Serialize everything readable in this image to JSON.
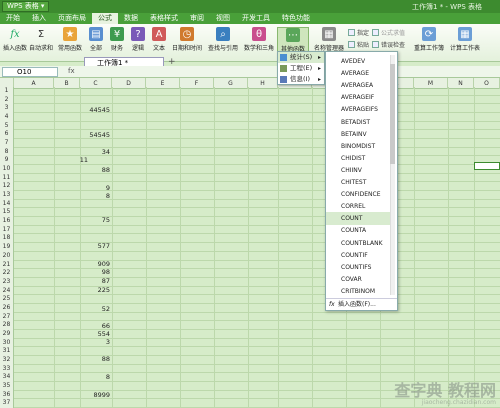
{
  "titlebar": {
    "app_name": "WPS 表格",
    "doc_title": "工作簿1 * - WPS 表格"
  },
  "menu": [
    "开始",
    "插入",
    "页面布局",
    "公式",
    "数据",
    "表格样式",
    "审阅",
    "视图",
    "开发工具",
    "特色功能"
  ],
  "ribbon": {
    "insert_function": "插入函数",
    "autosum": "自动求和",
    "common_functions": "常用函数",
    "all": "全部",
    "finance": "财务",
    "logical": "逻辑",
    "text": "文本",
    "datetime": "日期和时间",
    "lookup": "查找与引用",
    "math": "数学和三角",
    "other": "其他函数",
    "name_manager": "名称管理器",
    "paste": "粘贴",
    "specify": "指定",
    "formula_evaluate": "公式求值",
    "trace_error": "错误检查",
    "recalc": "重算工作簿",
    "calc_sheet": "计算工作表"
  },
  "formula_bar": {
    "name_box": "O10",
    "fx": "fx"
  },
  "tabs": {
    "doc_tab": "工作簿1 *",
    "plus": "+"
  },
  "columns": [
    "A",
    "B",
    "C",
    "D",
    "E",
    "F",
    "G",
    "H",
    "I",
    "J",
    "K",
    "L",
    "M",
    "N",
    "O"
  ],
  "rows": [
    "1",
    "2",
    "3",
    "4",
    "5",
    "6",
    "7",
    "8",
    "9",
    "10",
    "11",
    "12",
    "13",
    "14",
    "15",
    "16",
    "17",
    "18",
    "19",
    "20",
    "21",
    "22",
    "23",
    "24",
    "25",
    "26",
    "27",
    "28",
    "29",
    "30",
    "31",
    "32",
    "33",
    "34",
    "35",
    "36",
    "37"
  ],
  "cells": {
    "c3": "44545",
    "c6": "54545",
    "c8": "34",
    "b9": "11",
    "c10": "88",
    "c12": "9",
    "c13": "8",
    "c16": "75",
    "c20": "577",
    "c22": "909",
    "c23": "98",
    "c24": "87",
    "c25": "225",
    "c27": "52",
    "c29": "66",
    "c30": "554",
    "c31": "3",
    "c33": "88",
    "c35": "8",
    "c37": "8999"
  },
  "submenu": {
    "stats": "统计(S)",
    "engineering": "工程(E)",
    "info": "信息(I)"
  },
  "function_list": [
    "AVEDEV",
    "AVERAGE",
    "AVERAGEA",
    "AVERAGEIF",
    "AVERAGEIFS",
    "BETADIST",
    "BETAINV",
    "BINOMDIST",
    "CHIDIST",
    "CHIINV",
    "CHITEST",
    "CONFIDENCE",
    "CORREL",
    "COUNT",
    "COUNTA",
    "COUNTBLANK",
    "COUNTIF",
    "COUNTIFS",
    "COVAR",
    "CRITBINOM"
  ],
  "function_footer": "插入函数(F)...",
  "watermark": {
    "line1": "查字典 教程网",
    "line2": "jiaocheng.chazidian.com"
  },
  "colors": {
    "titlebar": "#3d8b2f",
    "menubar": "#49a039",
    "grid": "#d6ecc9",
    "highlight": "#d8ebcf"
  }
}
